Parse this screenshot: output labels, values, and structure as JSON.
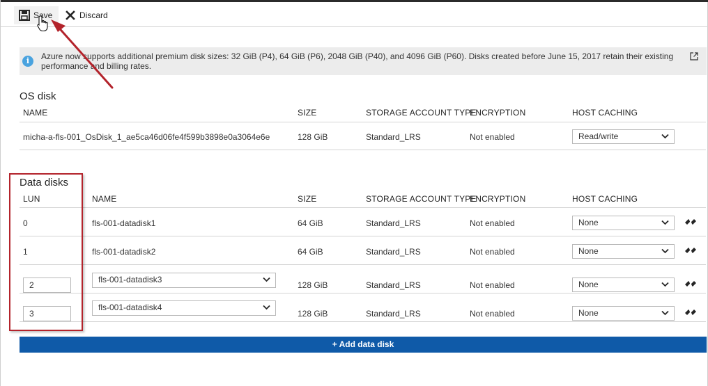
{
  "toolbar": {
    "save_label": "Save",
    "discard_label": "Discard"
  },
  "info_banner": {
    "text": "Azure now supports additional premium disk sizes: 32 GiB (P4), 64 GiB (P6), 2048 GiB (P40), and 4096 GiB (P60). Disks created before June 15, 2017 retain their existing performance and billing rates."
  },
  "os_disk": {
    "title": "OS disk",
    "columns": {
      "name": "NAME",
      "size": "SIZE",
      "storage": "STORAGE ACCOUNT TYPE",
      "encryption": "ENCRYPTION",
      "caching": "HOST CACHING"
    },
    "row": {
      "name": "micha-a-fls-001_OsDisk_1_ae5ca46d06fe4f599b3898e0a3064e6e",
      "size": "128 GiB",
      "storage": "Standard_LRS",
      "encryption": "Not enabled",
      "caching": "Read/write"
    }
  },
  "data_disks": {
    "title": "Data disks",
    "columns": {
      "lun": "LUN",
      "name": "NAME",
      "size": "SIZE",
      "storage": "STORAGE ACCOUNT TYPE",
      "encryption": "ENCRYPTION",
      "caching": "HOST CACHING"
    },
    "rows": [
      {
        "lun": "0",
        "name": "fls-001-datadisk1",
        "size": "64 GiB",
        "storage": "Standard_LRS",
        "encryption": "Not enabled",
        "caching": "None"
      },
      {
        "lun": "1",
        "name": "fls-001-datadisk2",
        "size": "64 GiB",
        "storage": "Standard_LRS",
        "encryption": "Not enabled",
        "caching": "None"
      },
      {
        "lun": "2",
        "name": "fls-001-datadisk3",
        "size": "128 GiB",
        "storage": "Standard_LRS",
        "encryption": "Not enabled",
        "caching": "None"
      },
      {
        "lun": "3",
        "name": "fls-001-datadisk4",
        "size": "128 GiB",
        "storage": "Standard_LRS",
        "encryption": "Not enabled",
        "caching": "None"
      }
    ],
    "add_label": "+ Add data disk"
  },
  "icons": {
    "save": "save-icon",
    "discard": "close-icon",
    "info": "info-icon",
    "external": "external-link-icon",
    "detach": "detach-icon",
    "dropdown": "chevron-down-icon"
  },
  "colors": {
    "accent": "#0f5aa8",
    "info_icon": "#4aa3df",
    "annotation": "#b3232b"
  }
}
